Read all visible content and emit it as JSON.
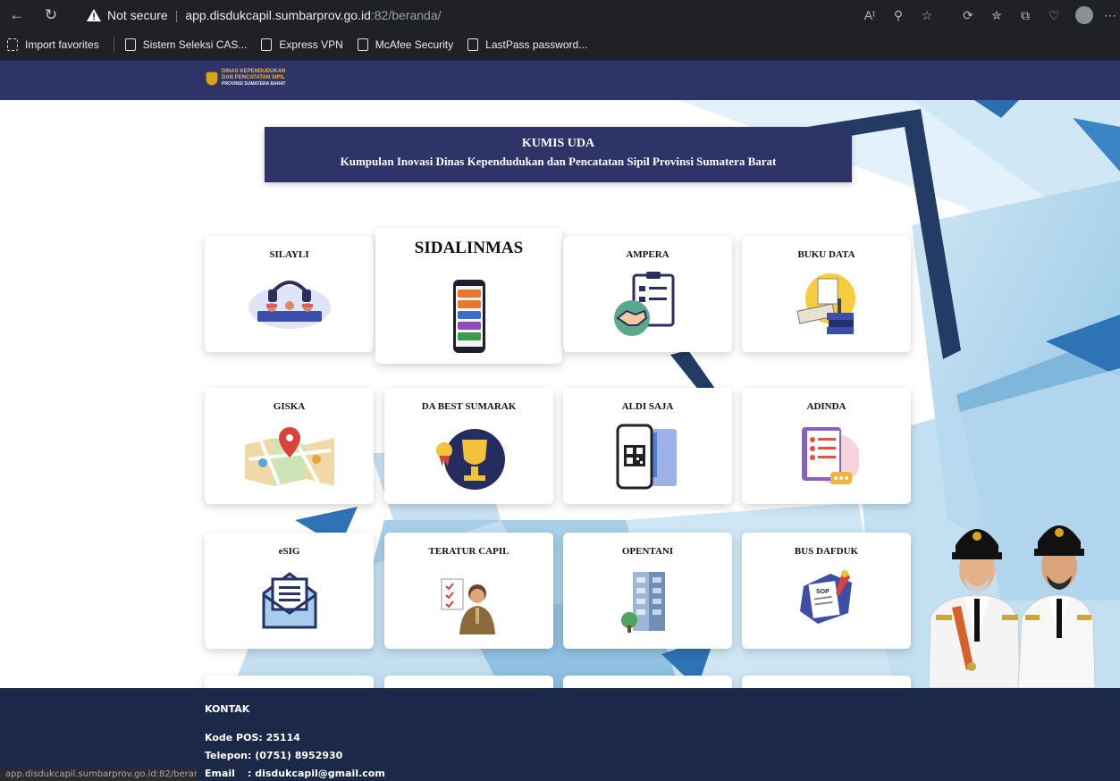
{
  "browser": {
    "security_label": "Not secure",
    "url_host": "app.disdukcapil.sumbarprov.go.id",
    "url_path": ":82/beranda/",
    "bookmarks": [
      "Import favorites",
      "Sistem Seleksi CAS...",
      "Express VPN",
      "McAfee Security",
      "LastPass password..."
    ]
  },
  "header": {
    "logo_line1": "DINAS KEPENDUDUKAN",
    "logo_line2": "DAN PENCATATAN SIPIL",
    "logo_line3": "PROVINSI SUMATERA BARAT"
  },
  "banner": {
    "title": "KUMIS UDA",
    "subtitle": "Kumpulan Inovasi Dinas Kependudukan dan Pencatatan Sipil Provinsi Sumatera Barat"
  },
  "cards": [
    {
      "title": "SILAYLI",
      "icon": "call-center-icon"
    },
    {
      "title": "SIDALINMAS",
      "icon": "mobile-app-icon"
    },
    {
      "title": "AMPERA",
      "icon": "handshake-checklist-icon"
    },
    {
      "title": "BUKU DATA",
      "icon": "books-icon"
    },
    {
      "title": "GISKA",
      "icon": "map-pin-icon"
    },
    {
      "title": "DA BEST SUMARAK",
      "icon": "trophy-icon"
    },
    {
      "title": "ALDI SAJA",
      "icon": "qr-phone-icon"
    },
    {
      "title": "ADINDA",
      "icon": "notebook-icon"
    },
    {
      "title": "eSIG",
      "icon": "envelope-icon"
    },
    {
      "title": "TERATUR CAPIL",
      "icon": "officer-icon"
    },
    {
      "title": "OPENTANI",
      "icon": "building-icon"
    },
    {
      "title": "BUS DAFDUK",
      "icon": "sop-document-icon"
    }
  ],
  "footer": {
    "title": "KONTAK",
    "kodepos_label": "Kode POS",
    "kodepos_value": ": 25114",
    "telepon_label": "Telepon",
    "telepon_value": ": (0751) 8952930",
    "email_label": "Email",
    "email_value": ": disdukcapil@gmail.com",
    "status_url": "app.disdukcapil.sumbarprov.go.id:82/beranda"
  },
  "colors": {
    "navy": "#2e3468",
    "footer": "#1b2848",
    "light_blue": "#a9d2ec"
  }
}
